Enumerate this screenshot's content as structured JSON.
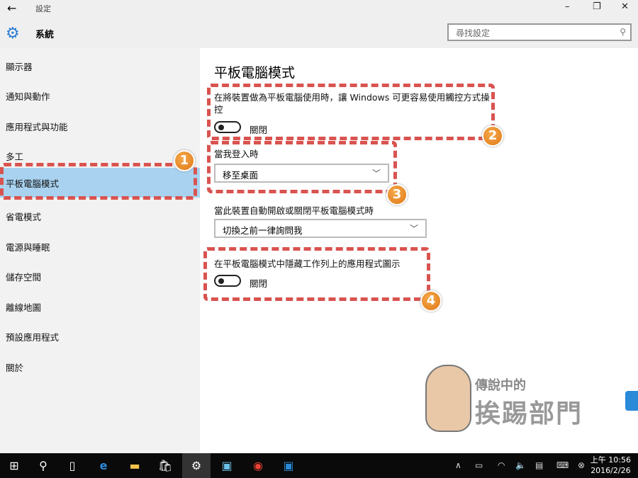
{
  "window": {
    "title": "設定",
    "back_icon": "←",
    "minimize": "–",
    "restore": "❐",
    "close": "✕"
  },
  "header": {
    "section": "系統",
    "search_placeholder": "尋找設定"
  },
  "sidebar": {
    "items": [
      {
        "label": "顯示器"
      },
      {
        "label": "通知與動作"
      },
      {
        "label": "應用程式與功能"
      },
      {
        "label": "多工"
      },
      {
        "label": "平板電腦模式",
        "selected": true
      },
      {
        "label": "省電模式"
      },
      {
        "label": "電源與睡眠"
      },
      {
        "label": "儲存空間"
      },
      {
        "label": "離線地圖"
      },
      {
        "label": "預設應用程式"
      },
      {
        "label": "關於"
      }
    ]
  },
  "main": {
    "title": "平板電腦模式",
    "tablet_desc": "在將裝置做為平板電腦使用時，讓 Windows 可更容易使用觸控方式操控",
    "tablet_toggle": {
      "state": "關閉",
      "on": false
    },
    "signin_label": "當我登入時",
    "signin_value": "移至桌面",
    "auto_label": "當此裝置自動開啟或關閉平板電腦模式時",
    "auto_value": "切換之前一律詢問我",
    "hide_icons_label": "在平板電腦模式中隱藏工作列上的應用程式圖示",
    "hide_toggle": {
      "state": "關閉",
      "on": false
    }
  },
  "annotations": [
    "1",
    "2",
    "3",
    "4"
  ],
  "annotation_color": "#d9534f",
  "watermark": {
    "line1": "傳說中的",
    "line2": "挨踢部門"
  },
  "taskbar": {
    "time": "上午 10:56",
    "date": "2016/2/26"
  }
}
